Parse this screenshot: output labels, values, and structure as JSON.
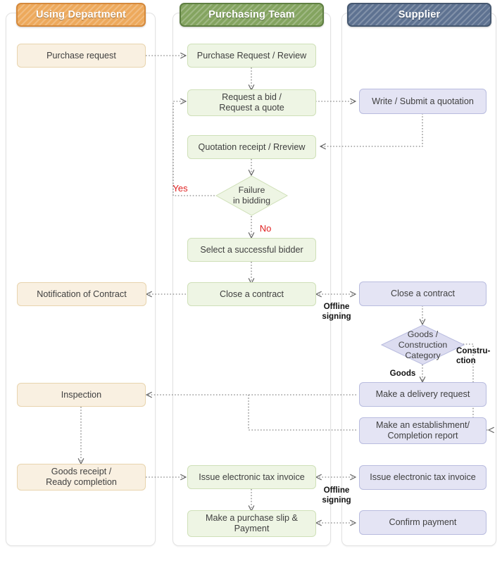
{
  "diagram": {
    "title": "Procurement Process Swimlane Flowchart",
    "lanes": [
      {
        "id": "using-department",
        "label": "Using Department",
        "color": "#eda95c",
        "border": "#d4893c"
      },
      {
        "id": "purchasing-team",
        "label": "Purchasing Team",
        "color": "#84a460",
        "border": "#5f7f42"
      },
      {
        "id": "supplier",
        "label": "Supplier",
        "color": "#5e7291",
        "border": "#465870"
      }
    ],
    "node_styles": {
      "beige": {
        "fill": "#f9f0e1",
        "stroke": "#e8d4ae"
      },
      "green": {
        "fill": "#eef5e4",
        "stroke": "#cfe0b8"
      },
      "lavender": {
        "fill": "#e4e4f4",
        "stroke": "#b9bcdf"
      }
    },
    "nodes": [
      {
        "id": "purchase-request",
        "lane": "using-department",
        "shape": "box",
        "style": "beige",
        "label": "Purchase request"
      },
      {
        "id": "purchase-request-review",
        "lane": "purchasing-team",
        "shape": "box",
        "style": "green",
        "label": "Purchase Request / Review"
      },
      {
        "id": "request-a-bid",
        "lane": "purchasing-team",
        "shape": "box",
        "style": "green",
        "label": "Request a bid /\nRequest a quote"
      },
      {
        "id": "write-submit-quotation",
        "lane": "supplier",
        "shape": "box",
        "style": "lavender",
        "label": "Write / Submit a quotation"
      },
      {
        "id": "quotation-receipt-review",
        "lane": "purchasing-team",
        "shape": "box",
        "style": "green",
        "label": "Quotation receipt / Rreview"
      },
      {
        "id": "failure-in-bidding",
        "lane": "purchasing-team",
        "shape": "diamond",
        "style": "green",
        "label": "Failure\nin bidding"
      },
      {
        "id": "select-successful-bidder",
        "lane": "purchasing-team",
        "shape": "box",
        "style": "green",
        "label": "Select a successful bidder"
      },
      {
        "id": "close-a-contract-pt",
        "lane": "purchasing-team",
        "shape": "box",
        "style": "green",
        "label": "Close a contract"
      },
      {
        "id": "notification-of-contract",
        "lane": "using-department",
        "shape": "box",
        "style": "beige",
        "label": "Notification of Contract"
      },
      {
        "id": "close-a-contract-sup",
        "lane": "supplier",
        "shape": "box",
        "style": "lavender",
        "label": "Close a contract"
      },
      {
        "id": "goods-construction-category",
        "lane": "supplier",
        "shape": "diamond",
        "style": "lavender",
        "label": "Goods /\nConstruction\nCategory"
      },
      {
        "id": "make-a-delivery-request",
        "lane": "supplier",
        "shape": "box",
        "style": "lavender",
        "label": "Make a delivery request"
      },
      {
        "id": "make-establishment-report",
        "lane": "supplier",
        "shape": "box",
        "style": "lavender",
        "label": "Make an establishment/\nCompletion report"
      },
      {
        "id": "inspection",
        "lane": "using-department",
        "shape": "box",
        "style": "beige",
        "label": "Inspection"
      },
      {
        "id": "goods-receipt",
        "lane": "using-department",
        "shape": "box",
        "style": "beige",
        "label": "Goods receipt /\nReady completion"
      },
      {
        "id": "issue-tax-invoice-pt",
        "lane": "purchasing-team",
        "shape": "box",
        "style": "green",
        "label": "Issue electronic tax invoice"
      },
      {
        "id": "issue-tax-invoice-sup",
        "lane": "supplier",
        "shape": "box",
        "style": "lavender",
        "label": "Issue electronic tax invoice"
      },
      {
        "id": "make-purchase-slip",
        "lane": "purchasing-team",
        "shape": "box",
        "style": "green",
        "label": "Make a purchase slip &\nPayment"
      },
      {
        "id": "confirm-payment",
        "lane": "supplier",
        "shape": "box",
        "style": "lavender",
        "label": "Confirm payment"
      }
    ],
    "edge_labels": [
      {
        "id": "yes",
        "text": "Yes",
        "color": "#e02020"
      },
      {
        "id": "no",
        "text": "No",
        "color": "#e02020"
      },
      {
        "id": "offline-signing-1",
        "text": "Offline\nsigning",
        "color": "#111111"
      },
      {
        "id": "offline-signing-2",
        "text": "Offline\nsigning",
        "color": "#111111"
      },
      {
        "id": "goods",
        "text": "Goods",
        "color": "#111111"
      },
      {
        "id": "construction",
        "text": "Constru-\nction",
        "color": "#111111"
      }
    ]
  }
}
